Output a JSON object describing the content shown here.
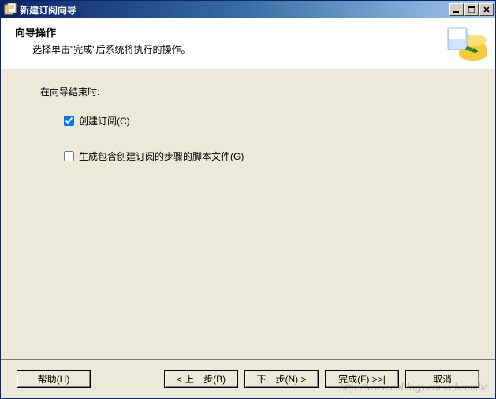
{
  "window": {
    "title": "新建订阅向导"
  },
  "header": {
    "title": "向导操作",
    "description": "选择单击\"完成\"后系统将执行的操作。"
  },
  "content": {
    "section_label": "在向导结束时:",
    "checkbox1": {
      "label": "创建订阅(C)",
      "checked": true
    },
    "checkbox2": {
      "label": "生成包含创建订阅的步骤的脚本文件(G)",
      "checked": false
    }
  },
  "buttons": {
    "help": "帮助(H)",
    "back": "< 上一步(B)",
    "next": "下一步(N) >",
    "finish": "完成(F) >>|",
    "cancel": "取消"
  },
  "watermark": "http://www.cnblogs.com/chenmh/"
}
